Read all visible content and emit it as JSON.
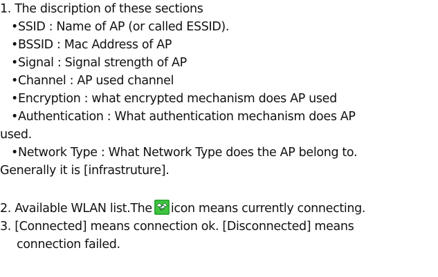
{
  "section1": {
    "heading": "1. The discription of these sections",
    "bullet_char": "•",
    "items": [
      "SSID : Name of AP (or called ESSID).",
      "BSSID : Mac Address of AP",
      "Signal : Signal strength of AP",
      "Channel : AP used channel",
      "Encryption : what encrypted mechanism does AP used",
      "Authentication : What authentication mechanism does AP",
      "Network Type : What Network Type does the AP belong to."
    ],
    "auth_continuation": "used.",
    "network_continuation": "Generally it is [infrastruture]."
  },
  "section2": {
    "text_before_icon": "2. Available WLAN list.The",
    "icon": "connecting-handshake-icon",
    "text_after_icon": "icon means currently connecting."
  },
  "section3": {
    "line1": "3. [Connected] means connection ok. [Disconnected] means",
    "line2": "connection failed."
  },
  "colors": {
    "text": "#111111",
    "icon_background": "#3fc43f",
    "icon_hands": "#ffffff"
  }
}
